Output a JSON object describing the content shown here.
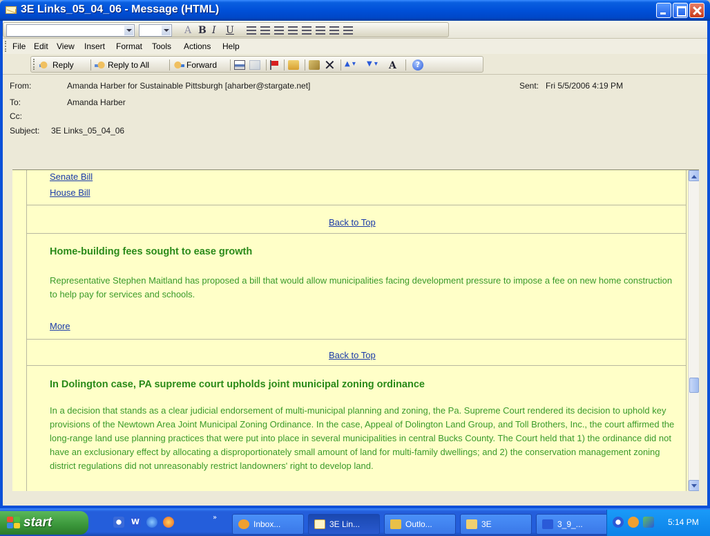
{
  "window": {
    "title": "3E Links_05_04_06 - Message (HTML)"
  },
  "menu": {
    "items": [
      "File",
      "Edit",
      "View",
      "Insert",
      "Format",
      "Tools",
      "Actions",
      "Help"
    ]
  },
  "toolbar": {
    "reply": "Reply",
    "reply_all": "Reply to All",
    "forward": "Forward"
  },
  "header": {
    "from_label": "From:",
    "from_value": "Amanda Harber for Sustainable Pittsburgh [aharber@stargate.net]",
    "sent_label": "Sent:",
    "sent_value": "Fri 5/5/2006 4:19 PM",
    "to_label": "To:",
    "to_value": "Amanda Harber",
    "cc_label": "Cc:",
    "subject_label": "Subject:",
    "subject_value": "3E Links_05_04_06"
  },
  "body": {
    "senate_link": "Senate Bill",
    "house_link": "House Bill",
    "back_to_top": "Back to Top",
    "article1": {
      "headline": "Home-building fees sought to ease growth",
      "text": "Representative Stephen Maitland has proposed a bill that would allow municipalities facing development pressure to impose a fee on new home construction to help pay for services and schools.",
      "more": "More"
    },
    "article2": {
      "headline": "In Dolington case, PA supreme court upholds joint municipal zoning ordinance",
      "text": "In a decision that stands as a clear judicial endorsement of multi-municipal planning and zoning, the Pa. Supreme Court rendered its decision to uphold key provisions of the Newtown Area Joint Municipal Zoning Ordinance. In the case, Appeal of Dolington Land Group, and Toll Brothers, Inc., the court affirmed the long-range land use planning practices that were put into place in several municipalities in central Bucks County. The Court held that 1) the ordinance did not have an exclusionary effect by allocating a disproportionately small amount of land for multi-family dwellings; and 2) the conservation management zoning district regulations did not unreasonably restrict landowners' right to develop land."
    }
  },
  "taskbar": {
    "start": "start",
    "tasks": [
      {
        "label": "Inbox...",
        "icon": "outlook-icon"
      },
      {
        "label": "3E Lin...",
        "icon": "mail-icon"
      },
      {
        "label": "Outlo...",
        "icon": "outlook-express-icon"
      },
      {
        "label": "3E",
        "icon": "folder-icon"
      },
      {
        "label": "3_9_...",
        "icon": "word-icon"
      }
    ],
    "clock": "5:14 PM"
  },
  "colors": {
    "headline": "#2a8a1a",
    "body_text": "#3a9a2a",
    "link": "#1a3aa8",
    "message_bg": "#ffffc8"
  }
}
